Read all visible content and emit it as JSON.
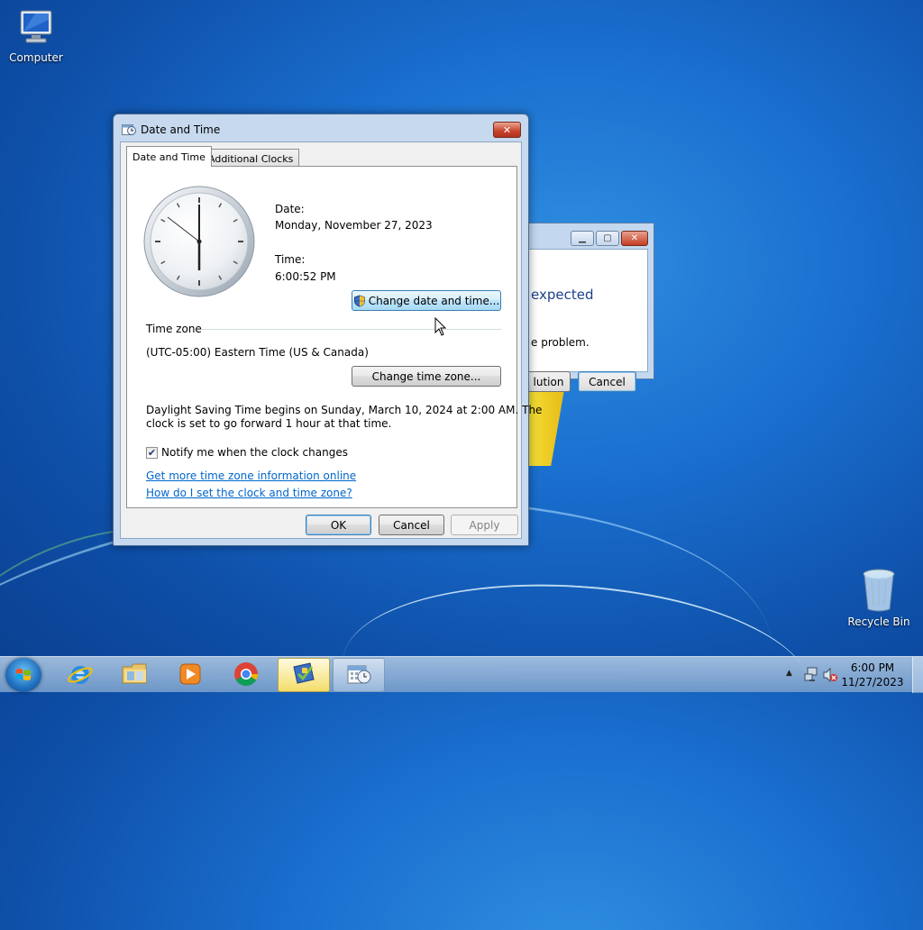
{
  "desktop": {
    "icons": [
      {
        "label": "Computer"
      },
      {
        "label": "Recycle Bin"
      }
    ]
  },
  "background_window": {
    "heading_fragment": "expected",
    "text_fragment": "e problem.",
    "solution_button_fragment": "lution",
    "cancel_button": "Cancel"
  },
  "dialog": {
    "title": "Date and Time",
    "tabs": [
      {
        "label": "Date and Time",
        "active": true
      },
      {
        "label": "Additional Clocks",
        "active": false
      }
    ],
    "date_label": "Date:",
    "date_value": "Monday, November 27, 2023",
    "time_label": "Time:",
    "time_value": "6:00:52 PM",
    "change_date_button": "Change date and time...",
    "timezone_heading": "Time zone",
    "timezone_value": "(UTC-05:00) Eastern Time (US & Canada)",
    "change_timezone_button": "Change time zone...",
    "dst_line1": "Daylight Saving Time begins on Sunday, March 10, 2024 at 2:00 AM. The",
    "dst_line2": "clock is set to go forward 1 hour at that time.",
    "notify_label": "Notify me when the clock changes",
    "notify_checked": true,
    "link_timezone_info": "Get more time zone information online",
    "link_how_set": "How do I set the clock and time zone?",
    "ok_button": "OK",
    "cancel_button": "Cancel",
    "apply_button": "Apply"
  },
  "taskbar": {
    "items": [
      "internet-explorer",
      "windows-explorer",
      "media-player",
      "chrome",
      "active-app",
      "date-time-app"
    ],
    "clock_time": "6:00 PM",
    "clock_date": "11/27/2023"
  },
  "colors": {
    "desktop_blue": "#1a6fcf",
    "link_blue": "#0066cc",
    "close_red": "#c7402a"
  }
}
